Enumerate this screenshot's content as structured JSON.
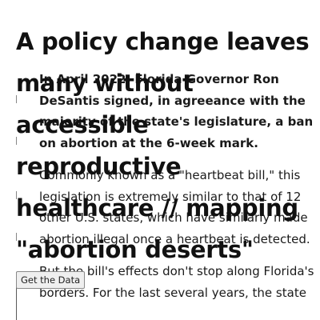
{
  "headline": "A policy change leaves many without accessible reproductive healthcare // mapping \"abortion deserts\"",
  "paragraphs": [
    "In April 2022, Florida Governor Ron DeSantis signed, in agreeance with the majority of the state's legislature, a ban on abortion at the 6-week mark.",
    "Commonly known as a \"heartbeat bill,\" this legislation is extremely similar to that of 12 other U.S. states, which have similarly made abortion illegal once a heartbeat is detected.",
    "But the bill's effects don't stop along Florida's borders. For the last several years, the state"
  ],
  "buttons": {
    "get_data": "Get the Data"
  },
  "colors": {
    "text": "#111111",
    "rule": "#888888",
    "button_bg": "#efefef"
  }
}
